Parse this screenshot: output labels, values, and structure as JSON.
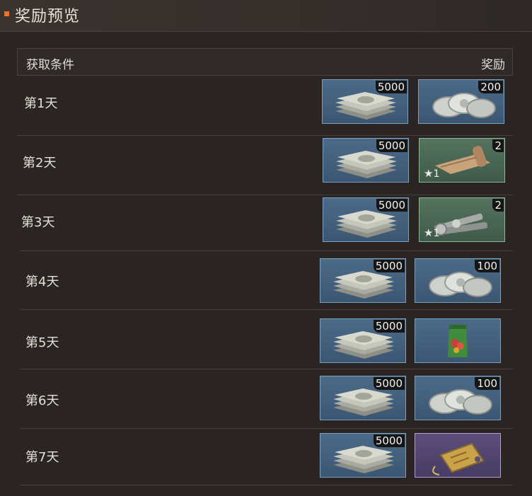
{
  "panel": {
    "title": "奖励预览"
  },
  "table_header": {
    "condition": "获取条件",
    "reward": "奖励"
  },
  "rows": [
    {
      "day": "第1天",
      "rewards": [
        {
          "icon": "cash-stack-icon",
          "rarity": "blue",
          "qty": "5000"
        },
        {
          "icon": "silver-coins-icon",
          "rarity": "blue",
          "qty": "200"
        }
      ]
    },
    {
      "day": "第2天",
      "rewards": [
        {
          "icon": "cash-stack-icon",
          "rarity": "blue",
          "qty": "5000"
        },
        {
          "icon": "leather-roll-icon",
          "rarity": "green",
          "qty": "2",
          "star_level": "1"
        }
      ]
    },
    {
      "day": "第3天",
      "rewards": [
        {
          "icon": "bolts-icon",
          "rarity": "blue",
          "qty": "5000"
        },
        {
          "icon": "bolts-icon",
          "rarity": "green",
          "qty": "2",
          "star_level": "1"
        }
      ]
    },
    {
      "day": "第4天",
      "rewards": [
        {
          "icon": "cash-stack-icon",
          "rarity": "blue",
          "qty": "5000"
        },
        {
          "icon": "silver-coins-icon",
          "rarity": "blue",
          "qty": "100"
        }
      ]
    },
    {
      "day": "第5天",
      "rewards": [
        {
          "icon": "cash-stack-icon",
          "rarity": "blue",
          "qty": "5000"
        },
        {
          "icon": "seed-packet-icon",
          "rarity": "blue",
          "qty": ""
        }
      ]
    },
    {
      "day": "第6天",
      "rewards": [
        {
          "icon": "cash-stack-icon",
          "rarity": "blue",
          "qty": "5000"
        },
        {
          "icon": "silver-coins-icon",
          "rarity": "blue",
          "qty": "100"
        }
      ]
    },
    {
      "day": "第7天",
      "rewards": [
        {
          "icon": "cash-stack-icon",
          "rarity": "blue",
          "qty": "5000"
        },
        {
          "icon": "gold-tag-icon",
          "rarity": "purple",
          "qty": ""
        }
      ]
    }
  ],
  "colors": {
    "accent": "#e8742a",
    "rarity_blue": "#4c6b88",
    "rarity_green": "#55735f",
    "rarity_purple": "#5c4e7a"
  }
}
